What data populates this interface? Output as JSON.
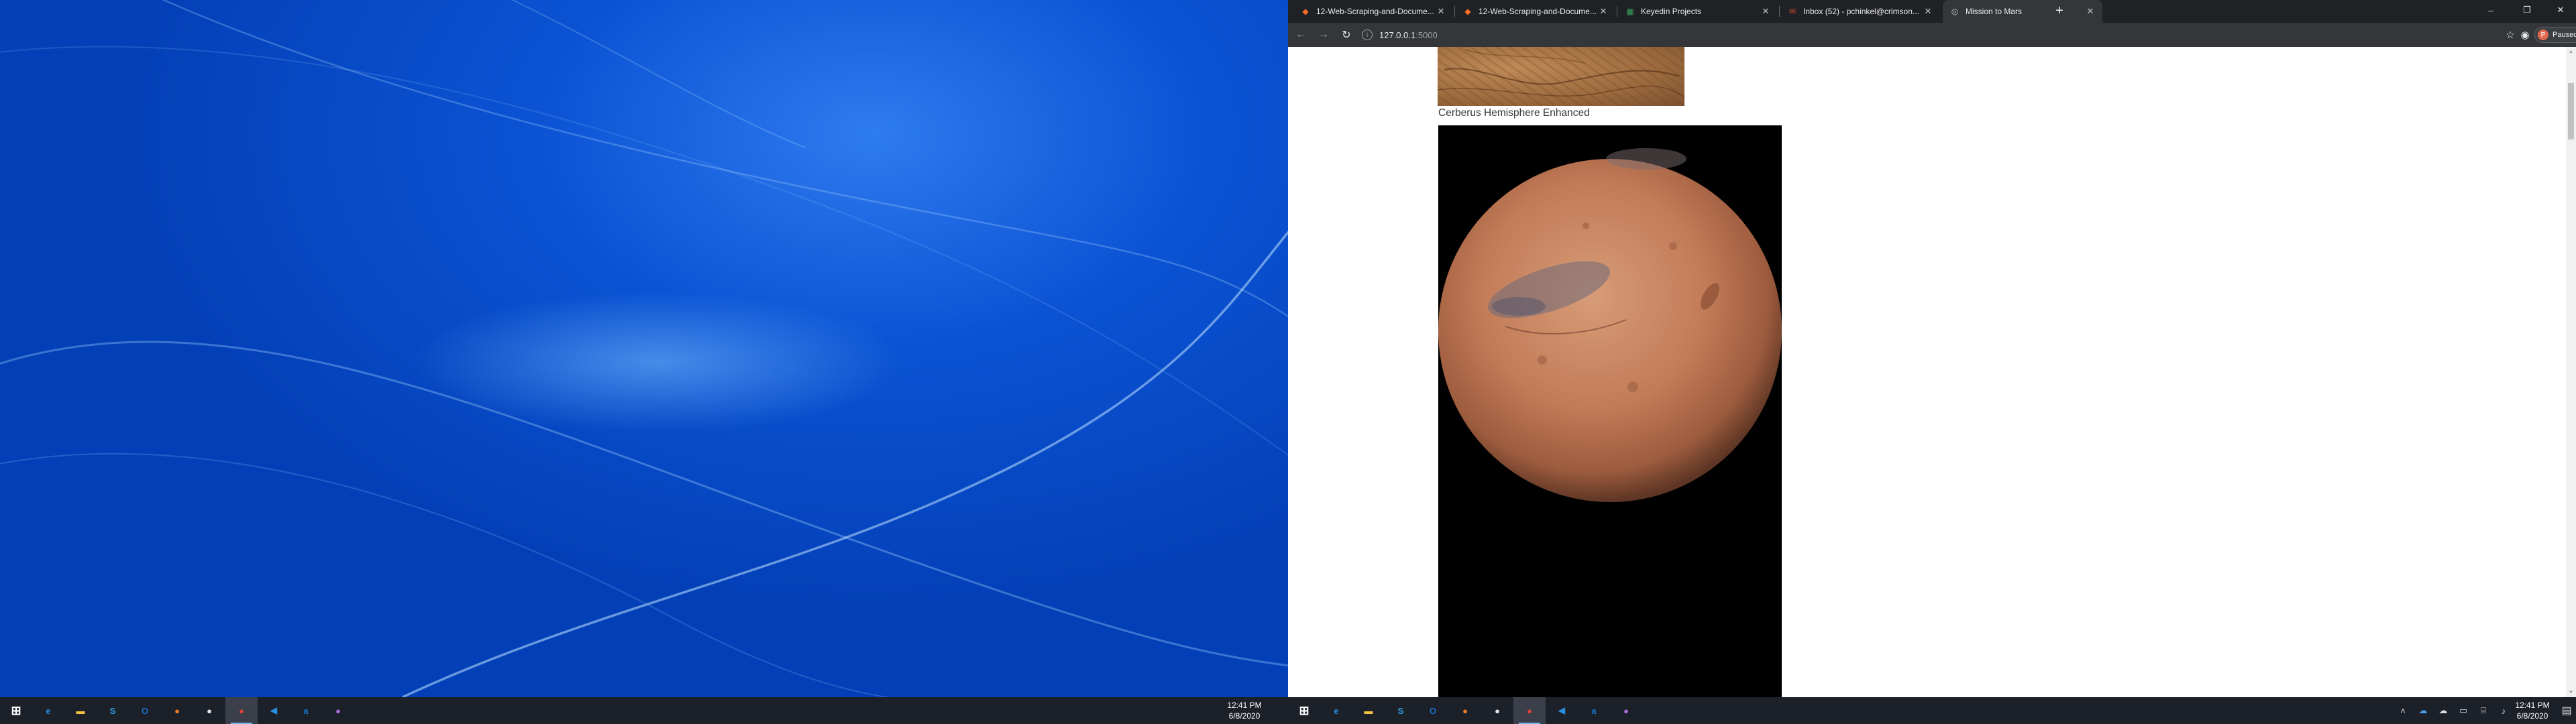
{
  "left_taskbar": {
    "apps": [
      {
        "name": "start-button",
        "glyph": "⊞",
        "color": "#ffffff"
      },
      {
        "name": "edge-icon",
        "glyph": "e",
        "color": "#1f8ce6"
      },
      {
        "name": "file-explorer-icon",
        "glyph": "▬",
        "color": "#f5c242"
      },
      {
        "name": "skype-icon",
        "glyph": "S",
        "color": "#2aa5e3"
      },
      {
        "name": "outlook-icon",
        "glyph": "O",
        "color": "#1e6fd0"
      },
      {
        "name": "firefox-icon",
        "glyph": "●",
        "color": "#f27c22"
      },
      {
        "name": "github-desktop-icon",
        "glyph": "●",
        "color": "#e9e9e9"
      },
      {
        "name": "chrome-icon",
        "glyph": "●",
        "color": "#e34133"
      },
      {
        "name": "vscode-icon",
        "glyph": "◀",
        "color": "#2b8fe0"
      },
      {
        "name": "amazon-icon",
        "glyph": "a",
        "color": "#1877d6"
      },
      {
        "name": "zoom-icon",
        "glyph": "●",
        "color": "#a56de0"
      }
    ],
    "time": "12:41 PM",
    "date": "6/8/2020"
  },
  "right_taskbar": {
    "time": "12:41 PM",
    "date": "6/8/2020",
    "tray": [
      "chevron-up-icon",
      "onedrive-icon",
      "cloud-icon",
      "battery-icon",
      "network-icon",
      "volume-icon"
    ]
  },
  "browser": {
    "tabs": [
      {
        "label": "12-Web-Scraping-and-Docume...",
        "favicon": "gitlab-icon",
        "favcolor": "#fc6d26",
        "active": false
      },
      {
        "label": "12-Web-Scraping-and-Docume...",
        "favicon": "gitlab-icon",
        "favcolor": "#fc6d26",
        "active": false
      },
      {
        "label": "Keyedin Projects",
        "favicon": "grid-icon",
        "favcolor": "#37a05a",
        "active": false
      },
      {
        "label": "Inbox (52) - pchinkel@crimson...",
        "favicon": "mail-icon",
        "favcolor": "#d04a3a",
        "active": false
      },
      {
        "label": "Mission to Mars",
        "favicon": "globe-icon",
        "favcolor": "#bdc1c6",
        "active": true
      }
    ],
    "new_tab": "+",
    "window_controls": {
      "minimize": "–",
      "restore": "❐",
      "close": "✕"
    },
    "nav": {
      "back": "←",
      "forward": "→",
      "reload": "↻"
    },
    "url": {
      "host": "127.0.0.1",
      "port": ":5000"
    },
    "profile": {
      "initial": "P",
      "status": "Paused"
    }
  },
  "page": {
    "hemisphere_title": "Cerberus Hemisphere Enhanced"
  }
}
